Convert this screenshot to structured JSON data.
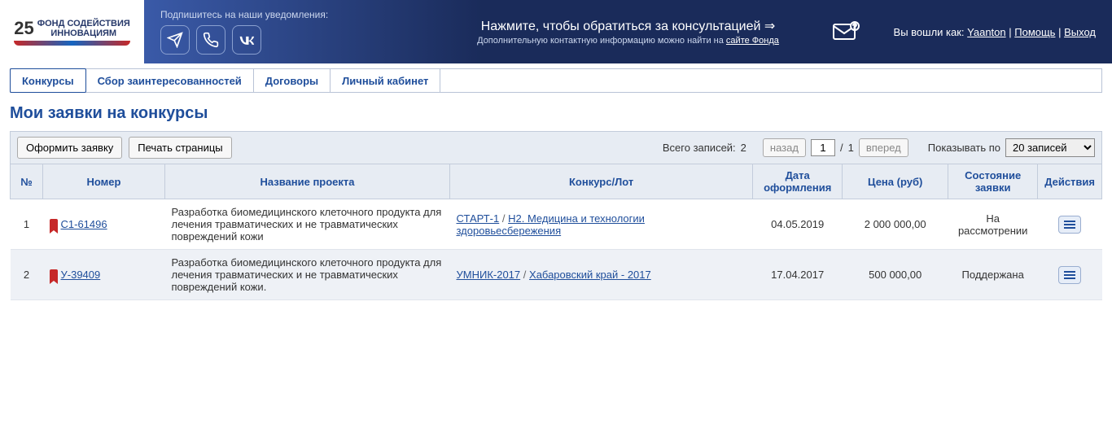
{
  "logo": {
    "num": "25",
    "line1": "ФОНД СОДЕЙСТВИЯ",
    "line2": "ИННОВАЦИЯМ"
  },
  "header": {
    "notif_label": "Подпишитесь на наши уведомления:",
    "consult_link": "Нажмите, чтобы обратиться за консультацией ⇒",
    "consult_sub_prefix": "Дополнительную контактную информацию можно найти на ",
    "consult_sub_link": "сайте Фонда",
    "user_prefix": "Вы вошли как: ",
    "user_name": "Yaanton",
    "help": "Помощь",
    "logout": "Выход"
  },
  "tabs": {
    "competitions": "Конкурсы",
    "interests": "Сбор заинтересованностей",
    "contracts": "Договоры",
    "cabinet": "Личный кабинет"
  },
  "page_title": "Мои заявки на конкурсы",
  "toolbar": {
    "apply": "Оформить заявку",
    "print": "Печать страницы",
    "total_label": "Всего записей:",
    "total_value": "2",
    "back": "назад",
    "page_value": "1",
    "slash": "/",
    "pages_total": "1",
    "forward": "вперед",
    "show_label": "Показывать по",
    "page_size": "20 записей"
  },
  "columns": {
    "num": "№",
    "number": "Номер",
    "title": "Название проекта",
    "contest": "Конкурс/Лот",
    "date": "Дата оформления",
    "price": "Цена (руб)",
    "status": "Состояние заявки",
    "actions": "Действия"
  },
  "rows": [
    {
      "idx": "1",
      "number": "С1-61496",
      "title": "Разработка биомедицинского клеточного продукта для лечения травматических и не травматических повреждений кожи",
      "contest_a": "СТАРТ-1",
      "contest_b": "Н2. Медицина и технологии здоровьесбережения",
      "date": "04.05.2019",
      "price": "2 000 000,00",
      "status": "На рассмотрении"
    },
    {
      "idx": "2",
      "number": "У-39409",
      "title": "Разработка биомедицинского клеточного продукта для лечения травматических и не травматических повреждений кожи.",
      "contest_a": "УМНИК-2017",
      "contest_b": "Хабаровский край - 2017",
      "date": "17.04.2017",
      "price": "500 000,00",
      "status": "Поддержана"
    }
  ]
}
